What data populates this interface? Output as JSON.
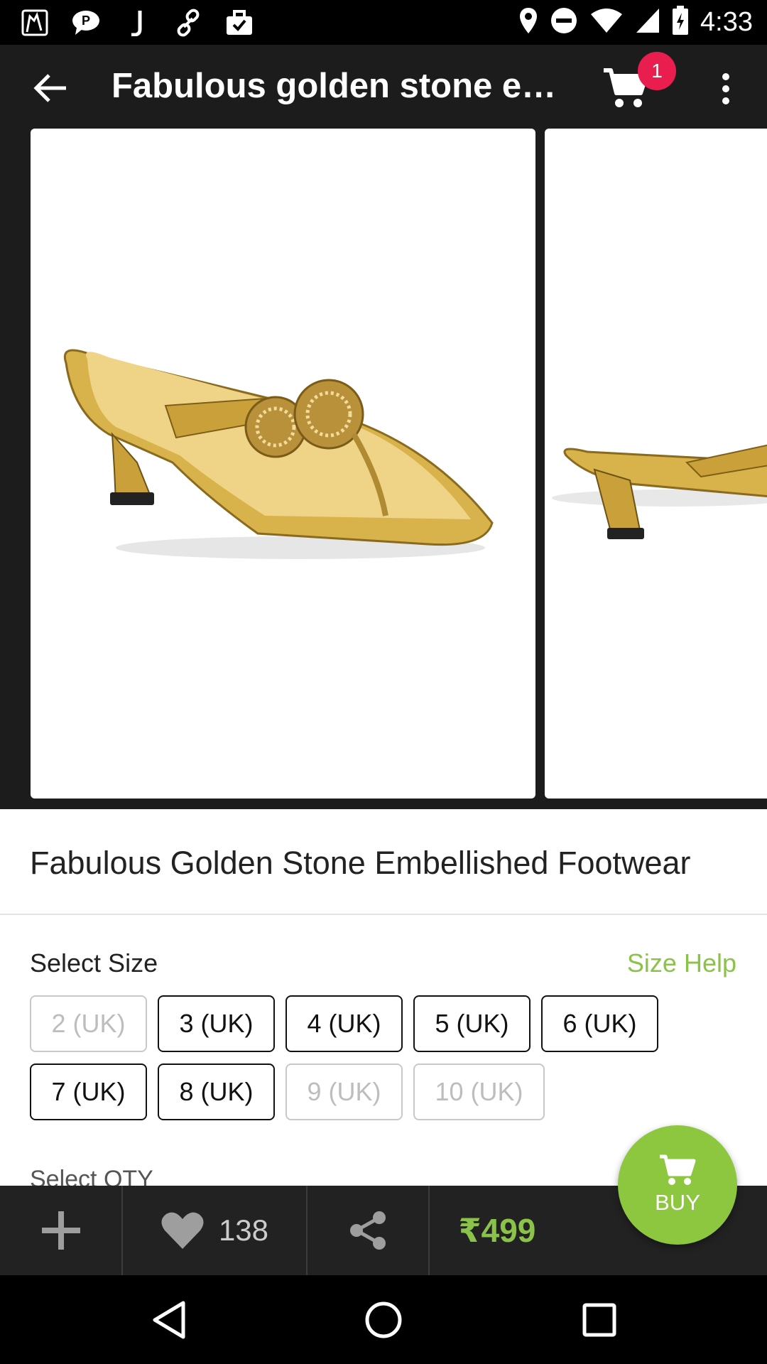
{
  "status_bar": {
    "time": "4:33",
    "left_icons": [
      "notification-app-icon",
      "chat-icon",
      "j-app-icon",
      "link-icon",
      "briefcase-icon"
    ],
    "right_icons": [
      "location-icon",
      "do-not-disturb-icon",
      "wifi-icon",
      "signal-icon",
      "battery-charging-icon"
    ]
  },
  "app_bar": {
    "title": "Fabulous golden stone em…",
    "cart_count": "1"
  },
  "gallery": {
    "images": [
      "golden-sandal-side-view",
      "golden-sandal-alt-view"
    ]
  },
  "product": {
    "name": "Fabulous Golden Stone Embellished Footwear",
    "select_size_label": "Select Size",
    "size_help_label": "Size Help",
    "sizes": [
      {
        "label": "2 (UK)",
        "available": false
      },
      {
        "label": "3 (UK)",
        "available": true
      },
      {
        "label": "4 (UK)",
        "available": true
      },
      {
        "label": "5 (UK)",
        "available": true
      },
      {
        "label": "6 (UK)",
        "available": true
      },
      {
        "label": "7 (UK)",
        "available": true
      },
      {
        "label": "8 (UK)",
        "available": true
      },
      {
        "label": "9 (UK)",
        "available": false
      },
      {
        "label": "10 (UK)",
        "available": false
      }
    ],
    "select_qty_label": "Select QTY"
  },
  "action_bar": {
    "like_count": "138",
    "price": "₹499",
    "buy_label": "BUY"
  },
  "colors": {
    "accent_green": "#8bc34a",
    "badge_red": "#e91e4f",
    "bar_dark": "#222222"
  }
}
